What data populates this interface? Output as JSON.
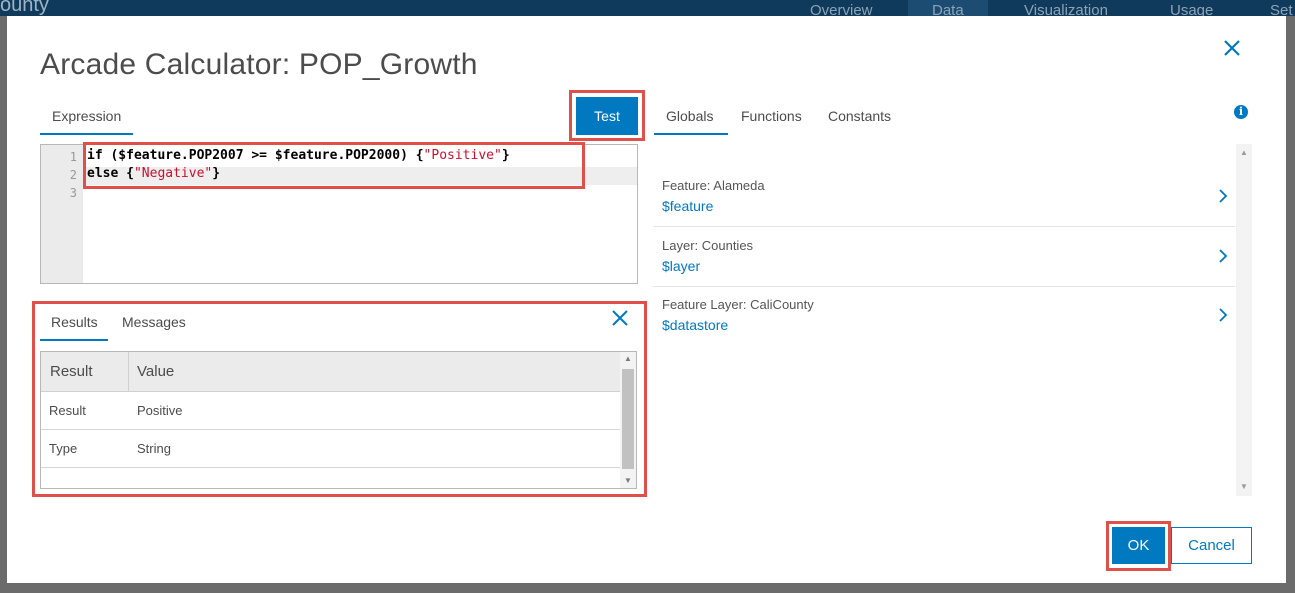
{
  "background": {
    "brand": "ounty",
    "nav": [
      "Overview",
      "Data",
      "Visualization",
      "Usage",
      "Set"
    ],
    "active_nav": "Data"
  },
  "dialog": {
    "title": "Arcade Calculator: POP_Growth",
    "close_icon": "close-icon",
    "expression_tab": "Expression",
    "test_button": "Test",
    "right_tabs": [
      "Globals",
      "Functions",
      "Constants"
    ],
    "info_icon": "info-icon",
    "info_glyph": "i"
  },
  "editor": {
    "line_numbers": [
      "1",
      "2",
      "3"
    ],
    "line1": {
      "code": "if ($feature.POP2007 >= $feature.POP2000) {",
      "string": "\"Positive\"",
      "close": "}"
    },
    "line2": {
      "code": "else {",
      "string": "\"Negative\"",
      "close": "}"
    }
  },
  "results": {
    "tabs": [
      "Results",
      "Messages"
    ],
    "close_icon": "close-icon",
    "columns": [
      "Result",
      "Value"
    ],
    "rows": [
      [
        "Result",
        "Positive"
      ],
      [
        "Type",
        "String"
      ]
    ]
  },
  "globals": [
    {
      "label": "Feature: Alameda",
      "value": "$feature"
    },
    {
      "label": "Layer: Counties",
      "value": "$layer"
    },
    {
      "label": "Feature Layer: CaliCounty",
      "value": "$datastore"
    }
  ],
  "footer": {
    "ok": "OK",
    "cancel": "Cancel"
  },
  "colors": {
    "accent": "#0079c1",
    "highlight_outline": "#e0504a",
    "string_literal": "#c8102e"
  }
}
